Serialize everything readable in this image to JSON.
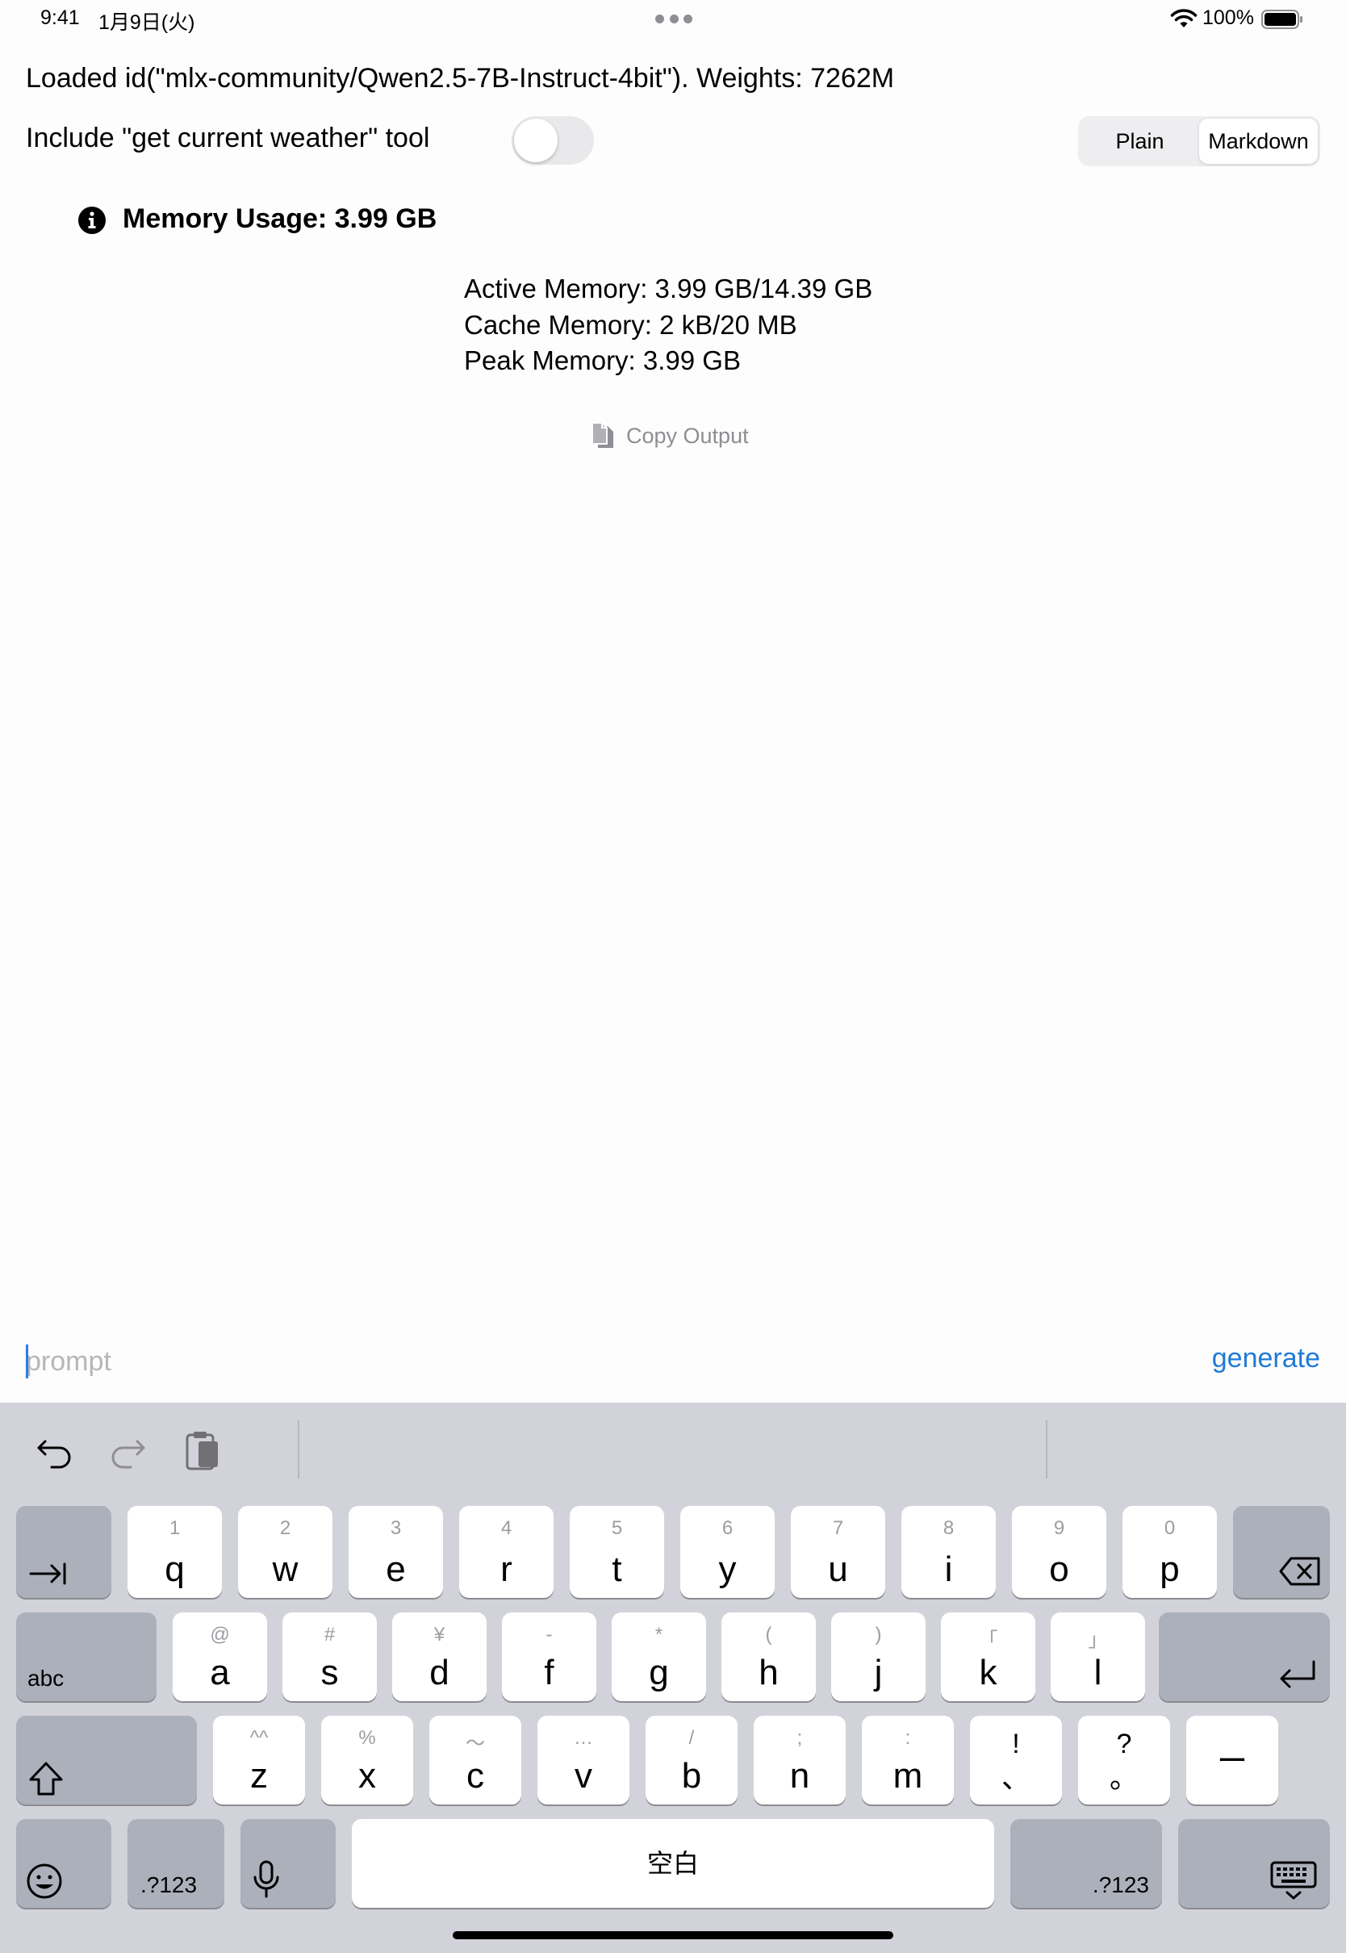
{
  "status_bar": {
    "time": "9:41",
    "date": "1月9日(火)",
    "battery_percent": "100%",
    "battery_level": 1.0
  },
  "header": {
    "loaded_text": "Loaded id(\"mlx-community/Qwen2.5-7B-Instruct-4bit\").  Weights: 7262M",
    "toggle_label": "Include \"get current weather\" tool",
    "toggle_on": false,
    "display_modes": [
      "Plain",
      "Markdown"
    ],
    "display_mode_selected": "Markdown"
  },
  "memory": {
    "title": "Memory Usage: 3.99 GB",
    "active": "Active Memory: 3.99 GB/14.39 GB",
    "cache": "Cache Memory: 2 kB/20 MB",
    "peak": "Peak Memory: 3.99 GB"
  },
  "copy_output_label": "Copy Output",
  "prompt": {
    "placeholder": "prompt",
    "value": ""
  },
  "generate_label": "generate",
  "keyboard": {
    "toolbar_icons": [
      "undo-icon",
      "redo-icon",
      "paste-icon"
    ],
    "row1": [
      {
        "main": "q",
        "sub": "1"
      },
      {
        "main": "w",
        "sub": "2"
      },
      {
        "main": "e",
        "sub": "3"
      },
      {
        "main": "r",
        "sub": "4"
      },
      {
        "main": "t",
        "sub": "5"
      },
      {
        "main": "y",
        "sub": "6"
      },
      {
        "main": "u",
        "sub": "7"
      },
      {
        "main": "i",
        "sub": "8"
      },
      {
        "main": "o",
        "sub": "9"
      },
      {
        "main": "p",
        "sub": "0"
      }
    ],
    "row2": [
      {
        "main": "a",
        "sub": "@"
      },
      {
        "main": "s",
        "sub": "#"
      },
      {
        "main": "d",
        "sub": "¥"
      },
      {
        "main": "f",
        "sub": "-"
      },
      {
        "main": "g",
        "sub": "*"
      },
      {
        "main": "h",
        "sub": "("
      },
      {
        "main": "j",
        "sub": ")"
      },
      {
        "main": "k",
        "sub": "「"
      },
      {
        "main": "l",
        "sub": "」"
      }
    ],
    "row3": [
      {
        "main": "z",
        "sub": "^^"
      },
      {
        "main": "x",
        "sub": "%"
      },
      {
        "main": "c",
        "sub": "〜"
      },
      {
        "main": "v",
        "sub": "…"
      },
      {
        "main": "b",
        "sub": "/"
      },
      {
        "main": "n",
        "sub": ";"
      },
      {
        "main": "m",
        "sub": ":"
      },
      {
        "main": "、",
        "sub": "!"
      },
      {
        "main": "。",
        "sub": "?"
      },
      {
        "main": "ー",
        "sub": ""
      }
    ],
    "abc_label": "abc",
    "numbers_label": ".?123",
    "space_label": "空白"
  }
}
